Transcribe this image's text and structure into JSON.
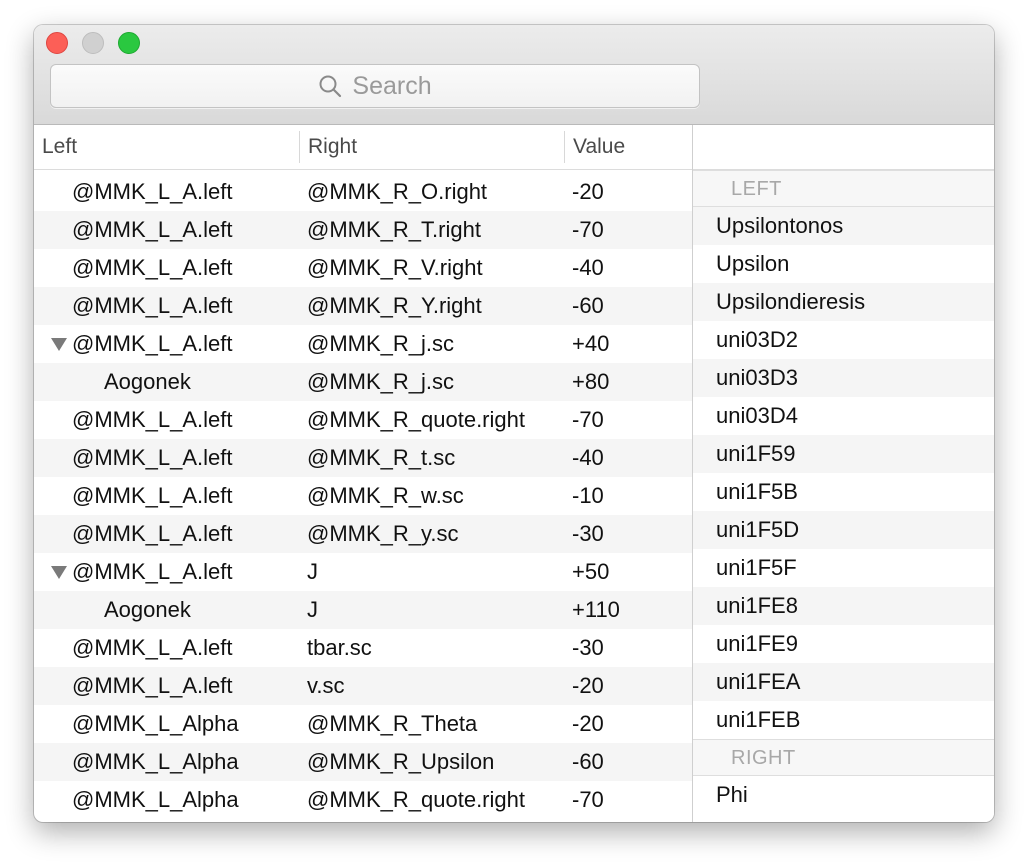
{
  "search": {
    "placeholder": "Search"
  },
  "columns": {
    "left": "Left",
    "right": "Right",
    "value": "Value"
  },
  "rows": [
    {
      "left": "@MMK_L_A.left",
      "right": "@MMK_R_O.right",
      "value": "-20",
      "expanded": false,
      "child": false
    },
    {
      "left": "@MMK_L_A.left",
      "right": "@MMK_R_T.right",
      "value": "-70",
      "expanded": false,
      "child": false
    },
    {
      "left": "@MMK_L_A.left",
      "right": "@MMK_R_V.right",
      "value": "-40",
      "expanded": false,
      "child": false
    },
    {
      "left": "@MMK_L_A.left",
      "right": "@MMK_R_Y.right",
      "value": "-60",
      "expanded": false,
      "child": false
    },
    {
      "left": "@MMK_L_A.left",
      "right": "@MMK_R_j.sc",
      "value": "+40",
      "expanded": true,
      "child": false
    },
    {
      "left": "Aogonek",
      "right": "@MMK_R_j.sc",
      "value": "+80",
      "expanded": false,
      "child": true
    },
    {
      "left": "@MMK_L_A.left",
      "right": "@MMK_R_quote.right",
      "value": "-70",
      "expanded": false,
      "child": false
    },
    {
      "left": "@MMK_L_A.left",
      "right": "@MMK_R_t.sc",
      "value": "-40",
      "expanded": false,
      "child": false
    },
    {
      "left": "@MMK_L_A.left",
      "right": "@MMK_R_w.sc",
      "value": "-10",
      "expanded": false,
      "child": false
    },
    {
      "left": "@MMK_L_A.left",
      "right": "@MMK_R_y.sc",
      "value": "-30",
      "expanded": false,
      "child": false
    },
    {
      "left": "@MMK_L_A.left",
      "right": "J",
      "value": "+50",
      "expanded": true,
      "child": false
    },
    {
      "left": "Aogonek",
      "right": "J",
      "value": "+110",
      "expanded": false,
      "child": true
    },
    {
      "left": "@MMK_L_A.left",
      "right": "tbar.sc",
      "value": "-30",
      "expanded": false,
      "child": false
    },
    {
      "left": "@MMK_L_A.left",
      "right": "v.sc",
      "value": "-20",
      "expanded": false,
      "child": false
    },
    {
      "left": "@MMK_L_Alpha",
      "right": "@MMK_R_Theta",
      "value": "-20",
      "expanded": false,
      "child": false
    },
    {
      "left": "@MMK_L_Alpha",
      "right": "@MMK_R_Upsilon",
      "value": "-60",
      "expanded": false,
      "child": false
    },
    {
      "left": "@MMK_L_Alpha",
      "right": "@MMK_R_quote.right",
      "value": "-70",
      "expanded": false,
      "child": false
    }
  ],
  "sidebar": {
    "left_header": "LEFT",
    "left_items": [
      "Upsilontonos",
      "Upsilon",
      "Upsilondieresis",
      "uni03D2",
      "uni03D3",
      "uni03D4",
      "uni1F59",
      "uni1F5B",
      "uni1F5D",
      "uni1F5F",
      "uni1FE8",
      "uni1FE9",
      "uni1FEA",
      "uni1FEB"
    ],
    "right_header": "RIGHT",
    "right_items": [
      "Phi"
    ]
  }
}
